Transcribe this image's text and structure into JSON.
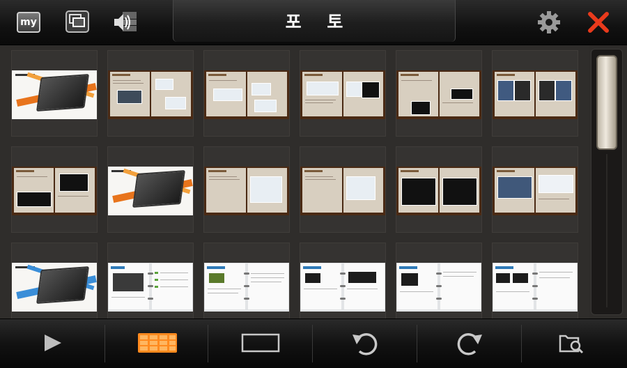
{
  "header": {
    "title": "포 토",
    "my_label": "my"
  },
  "toolbar": {
    "buttons": [
      {
        "name": "play",
        "icon": "play-icon"
      },
      {
        "name": "grid-view",
        "icon": "grid-view-icon",
        "active": true
      },
      {
        "name": "single-view",
        "icon": "single-view-icon"
      },
      {
        "name": "rotate-left",
        "icon": "rotate-left-icon"
      },
      {
        "name": "rotate-right",
        "icon": "rotate-right-icon"
      },
      {
        "name": "folder-search",
        "icon": "folder-search-icon"
      }
    ]
  },
  "gallery": {
    "rows": [
      [
        "cover",
        "book",
        "book",
        "book",
        "book",
        "book"
      ],
      [
        "book",
        "cover",
        "book",
        "book",
        "book",
        "book"
      ],
      [
        "cover-blue",
        "spiral",
        "spiral",
        "spiral",
        "spiral",
        "spiral"
      ]
    ]
  },
  "scrollbar": {
    "position": 0.0
  },
  "colors": {
    "accent_orange": "#ff8a1e",
    "close_red": "#e83a1c",
    "page_beige": "#d8cfc0",
    "book_brown": "#4a2a14"
  }
}
